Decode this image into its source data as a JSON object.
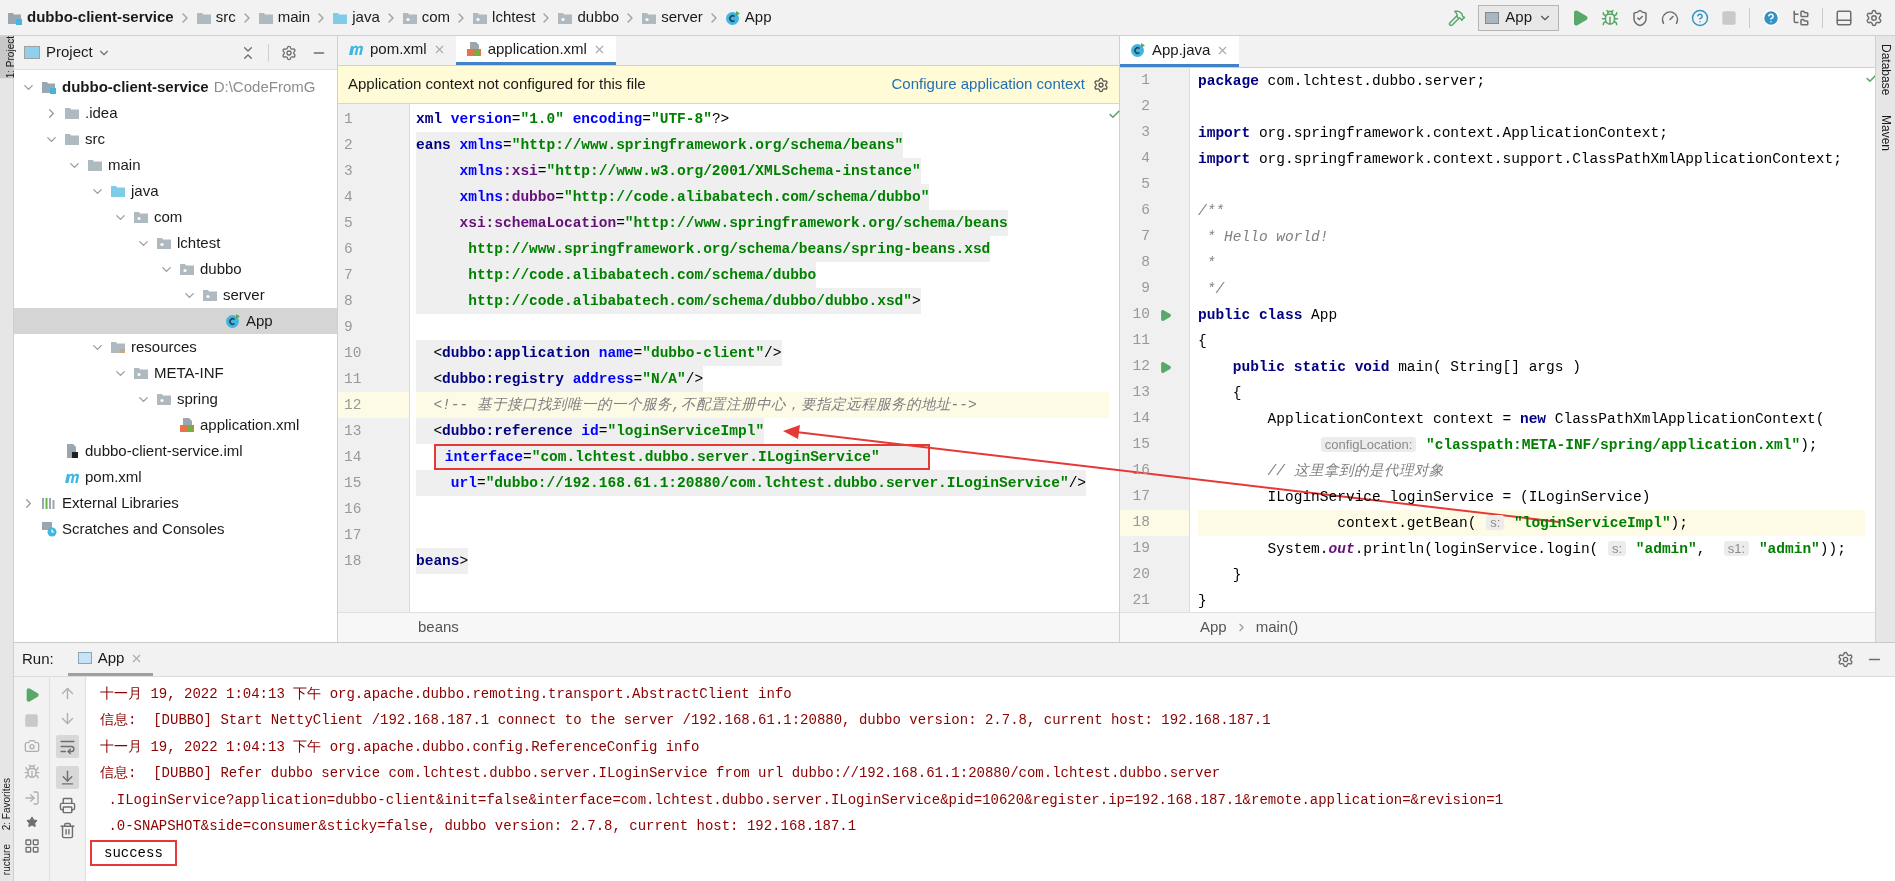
{
  "breadcrumb": [
    {
      "label": "dubbo-client-service",
      "kind": "module"
    },
    {
      "label": "src",
      "kind": "folder"
    },
    {
      "label": "main",
      "kind": "folder"
    },
    {
      "label": "java",
      "kind": "source"
    },
    {
      "label": "com",
      "kind": "package"
    },
    {
      "label": "lchtest",
      "kind": "package"
    },
    {
      "label": "dubbo",
      "kind": "package"
    },
    {
      "label": "server",
      "kind": "package"
    },
    {
      "label": "App",
      "kind": "class"
    }
  ],
  "run_config": {
    "label": "App"
  },
  "left_stripe": {
    "top": "1: Project",
    "bottom": [
      "2: Favorites",
      "ructure"
    ]
  },
  "right_stripe": [
    "Database",
    "Maven"
  ],
  "project": {
    "title": "Project",
    "tree": [
      {
        "label": "dubbo-client-service",
        "path": "D:\\CodeFromG",
        "kind": "module",
        "expanded": true,
        "selected": false,
        "children": [
          {
            "label": ".idea",
            "kind": "folder",
            "expanded": false,
            "selected": false
          },
          {
            "label": "src",
            "kind": "folder",
            "expanded": true,
            "selected": false,
            "children": [
              {
                "label": "main",
                "kind": "folder",
                "expanded": true,
                "selected": false,
                "children": [
                  {
                    "label": "java",
                    "kind": "source",
                    "expanded": true,
                    "selected": false,
                    "children": [
                      {
                        "label": "com",
                        "kind": "package",
                        "expanded": true,
                        "selected": false,
                        "children": [
                          {
                            "label": "lchtest",
                            "kind": "package",
                            "expanded": true,
                            "selected": false,
                            "children": [
                              {
                                "label": "dubbo",
                                "kind": "package",
                                "expanded": true,
                                "selected": false,
                                "children": [
                                  {
                                    "label": "server",
                                    "kind": "package",
                                    "expanded": true,
                                    "selected": false,
                                    "children": [
                                      {
                                        "label": "App",
                                        "kind": "class",
                                        "selected": true
                                      }
                                    ]
                                  }
                                ]
                              }
                            ]
                          }
                        ]
                      }
                    ]
                  },
                  {
                    "label": "resources",
                    "kind": "resources",
                    "expanded": true,
                    "selected": false,
                    "children": [
                      {
                        "label": "META-INF",
                        "kind": "package",
                        "expanded": true,
                        "selected": false,
                        "children": [
                          {
                            "label": "spring",
                            "kind": "package",
                            "expanded": true,
                            "selected": false,
                            "children": [
                              {
                                "label": "application.xml",
                                "kind": "xml",
                                "selected": false
                              }
                            ]
                          }
                        ]
                      }
                    ]
                  }
                ]
              }
            ]
          },
          {
            "label": "dubbo-client-service.iml",
            "kind": "iml",
            "selected": false
          },
          {
            "label": "pom.xml",
            "kind": "maven",
            "selected": false
          }
        ]
      },
      {
        "label": "External Libraries",
        "kind": "libraries",
        "expanded": false,
        "selected": false
      },
      {
        "label": "Scratches and Consoles",
        "kind": "scratches",
        "selected": false
      }
    ]
  },
  "xml_editor": {
    "tabs": [
      {
        "label": "pom.xml",
        "kind": "maven",
        "selected": false
      },
      {
        "label": "application.xml",
        "kind": "xml",
        "selected": true
      }
    ],
    "banner": {
      "text": "Application context not configured for this file",
      "link": "Configure application context"
    },
    "lines": [
      {
        "number": "1",
        "shaded": false,
        "current": false,
        "boxed": false,
        "tokens": [
          {
            "kind": "tag",
            "text": "xml"
          },
          {
            "kind": "attr",
            "text": " version"
          },
          {
            "kind": "plain",
            "text": "="
          },
          {
            "kind": "str",
            "text": "\"1.0\""
          },
          {
            "kind": "attr",
            "text": " encoding"
          },
          {
            "kind": "plain",
            "text": "="
          },
          {
            "kind": "str",
            "text": "\"UTF-8\""
          },
          {
            "kind": "plain",
            "text": "?>"
          }
        ]
      },
      {
        "number": "2",
        "shaded": true,
        "current": false,
        "boxed": false,
        "tokens": [
          {
            "kind": "tag",
            "text": "eans"
          },
          {
            "kind": "attr",
            "text": " xmlns"
          },
          {
            "kind": "plain",
            "text": "="
          },
          {
            "kind": "str",
            "text": "\"http://www.springframework.org/schema/beans\""
          }
        ]
      },
      {
        "number": "3",
        "shaded": true,
        "current": false,
        "boxed": false,
        "tokens": [
          {
            "kind": "attr",
            "text": "     xmlns"
          },
          {
            "kind": "ns",
            "text": ":xsi"
          },
          {
            "kind": "plain",
            "text": "="
          },
          {
            "kind": "str",
            "text": "\"http://www.w3.org/2001/XMLSchema-instance\""
          }
        ]
      },
      {
        "number": "4",
        "shaded": true,
        "current": false,
        "boxed": false,
        "tokens": [
          {
            "kind": "attr",
            "text": "     xmlns"
          },
          {
            "kind": "ns",
            "text": ":dubbo"
          },
          {
            "kind": "plain",
            "text": "="
          },
          {
            "kind": "str",
            "text": "\"http://code.alibabatech.com/schema/dubbo\""
          }
        ]
      },
      {
        "number": "5",
        "shaded": true,
        "current": false,
        "boxed": false,
        "tokens": [
          {
            "kind": "ns",
            "text": "     xsi:schemaLocation"
          },
          {
            "kind": "plain",
            "text": "="
          },
          {
            "kind": "str",
            "text": "\"http://www.springframework.org/schema/beans"
          }
        ]
      },
      {
        "number": "6",
        "shaded": true,
        "current": false,
        "boxed": false,
        "tokens": [
          {
            "kind": "str",
            "text": "      http://www.springframework.org/schema/beans/spring-beans.xsd"
          }
        ]
      },
      {
        "number": "7",
        "shaded": true,
        "current": false,
        "boxed": false,
        "tokens": [
          {
            "kind": "str",
            "text": "      http://code.alibabatech.com/schema/dubbo"
          }
        ]
      },
      {
        "number": "8",
        "shaded": true,
        "current": false,
        "boxed": false,
        "tokens": [
          {
            "kind": "str",
            "text": "      http://code.alibabatech.com/schema/dubbo/dubbo.xsd\""
          },
          {
            "kind": "plain",
            "text": ">"
          }
        ]
      },
      {
        "number": "9",
        "current": false
      },
      {
        "number": "10",
        "shaded": true,
        "current": false,
        "boxed": false,
        "tokens": [
          {
            "kind": "plain",
            "text": "  <"
          },
          {
            "kind": "tag",
            "text": "dubbo:application"
          },
          {
            "kind": "attr",
            "text": " name"
          },
          {
            "kind": "plain",
            "text": "="
          },
          {
            "kind": "str",
            "text": "\"dubbo-client\""
          },
          {
            "kind": "plain",
            "text": "/>"
          }
        ]
      },
      {
        "number": "11",
        "shaded": true,
        "current": false,
        "boxed": false,
        "tokens": [
          {
            "kind": "plain",
            "text": "  <"
          },
          {
            "kind": "tag",
            "text": "dubbo:registry"
          },
          {
            "kind": "attr",
            "text": " address"
          },
          {
            "kind": "plain",
            "text": "="
          },
          {
            "kind": "str",
            "text": "\"N/A\""
          },
          {
            "kind": "plain",
            "text": "/>"
          }
        ]
      },
      {
        "number": "12",
        "shaded": false,
        "current": true,
        "boxed": false,
        "tokens": [
          {
            "kind": "comment",
            "text": "  <!-- 基于接口找到唯一的一个服务,不配置注册中心，要指定远程服务的地址-->"
          }
        ]
      },
      {
        "number": "13",
        "shaded": true,
        "current": false,
        "boxed": false,
        "tokens": [
          {
            "kind": "plain",
            "text": "  <"
          },
          {
            "kind": "tag",
            "text": "dubbo:reference"
          },
          {
            "kind": "attr",
            "text": " id"
          },
          {
            "kind": "plain",
            "text": "="
          },
          {
            "kind": "str",
            "text": "\"loginServiceImpl\""
          }
        ]
      },
      {
        "number": "14",
        "shaded": true,
        "current": false,
        "boxed": true,
        "tokens": [
          {
            "kind": "attr",
            "text": " interface"
          },
          {
            "kind": "plain",
            "text": "="
          },
          {
            "kind": "str",
            "text": "\"com.lchtest.dubbo.server.ILoginService\""
          }
        ]
      },
      {
        "number": "15",
        "shaded": true,
        "current": false,
        "boxed": false,
        "tokens": [
          {
            "kind": "attr",
            "text": "    url"
          },
          {
            "kind": "plain",
            "text": "="
          },
          {
            "kind": "str",
            "text": "\"dubbo://192.168.61.1:20880/com.lchtest.dubbo.server.ILoginService\""
          },
          {
            "kind": "plain",
            "text": "/>"
          }
        ]
      },
      {
        "number": "16",
        "current": false
      },
      {
        "number": "17",
        "current": false
      },
      {
        "number": "18",
        "shaded": true,
        "current": false,
        "boxed": false,
        "tokens": [
          {
            "kind": "tag",
            "text": "beans"
          },
          {
            "kind": "plain",
            "text": ">"
          }
        ]
      }
    ],
    "crumbs": [
      "beans"
    ]
  },
  "java_editor": {
    "tabs": [
      {
        "label": "App.java",
        "kind": "class",
        "selected": true
      }
    ],
    "lines": [
      {
        "number": "1",
        "run": false,
        "current": false,
        "tokens": [
          {
            "kind": "kw",
            "text": "package"
          },
          {
            "kind": "plain",
            "text": " com.lchtest.dubbo.server;"
          }
        ]
      },
      {
        "number": "2",
        "run": false,
        "current": false
      },
      {
        "number": "3",
        "run": false,
        "current": false,
        "tokens": [
          {
            "kind": "kw",
            "text": "import"
          },
          {
            "kind": "plain",
            "text": " org.springframework.context.ApplicationContext;"
          }
        ]
      },
      {
        "number": "4",
        "run": false,
        "current": false,
        "tokens": [
          {
            "kind": "kw",
            "text": "import"
          },
          {
            "kind": "plain",
            "text": " org.springframework.context.support.ClassPathXmlApplicationContext;"
          }
        ]
      },
      {
        "number": "5",
        "run": false,
        "current": false
      },
      {
        "number": "6",
        "run": false,
        "current": false,
        "tokens": [
          {
            "kind": "comment",
            "text": "/**"
          }
        ]
      },
      {
        "number": "7",
        "run": false,
        "current": false,
        "tokens": [
          {
            "kind": "comment",
            "text": " * Hello world!"
          }
        ]
      },
      {
        "number": "8",
        "run": false,
        "current": false,
        "tokens": [
          {
            "kind": "comment",
            "text": " *"
          }
        ]
      },
      {
        "number": "9",
        "run": false,
        "current": false,
        "tokens": [
          {
            "kind": "comment",
            "text": " */"
          }
        ]
      },
      {
        "number": "10",
        "run": true,
        "current": false,
        "tokens": [
          {
            "kind": "kw",
            "text": "public class"
          },
          {
            "kind": "plain",
            "text": " App"
          }
        ]
      },
      {
        "number": "11",
        "run": false,
        "current": false,
        "tokens": [
          {
            "kind": "plain",
            "text": "{"
          }
        ]
      },
      {
        "number": "12",
        "run": true,
        "current": false,
        "tokens": [
          {
            "kind": "kw",
            "text": "    public static void"
          },
          {
            "kind": "plain",
            "text": " main( String[] args )"
          }
        ]
      },
      {
        "number": "13",
        "run": false,
        "current": false,
        "tokens": [
          {
            "kind": "plain",
            "text": "    {"
          }
        ]
      },
      {
        "number": "14",
        "run": false,
        "current": false,
        "tokens": [
          {
            "kind": "plain",
            "text": "        ApplicationContext context = "
          },
          {
            "kind": "kw",
            "text": "new"
          },
          {
            "kind": "plain",
            "text": " ClassPathXmlApplicationContext("
          }
        ]
      },
      {
        "number": "15",
        "run": false,
        "current": false,
        "tokens": [
          {
            "kind": "hint",
            "text": "              configLocation:"
          },
          {
            "kind": "str",
            "text": " \"classpath:META-INF/spring/application.xml\""
          },
          {
            "kind": "plain",
            "text": ");"
          }
        ]
      },
      {
        "number": "16",
        "run": false,
        "current": false,
        "tokens": [
          {
            "kind": "comment",
            "text": "        // 这里拿到的是代理对象"
          }
        ]
      },
      {
        "number": "17",
        "run": false,
        "current": false,
        "tokens": [
          {
            "kind": "plain",
            "text": "        ILoginService loginService = (ILoginService)"
          }
        ]
      },
      {
        "number": "18",
        "run": false,
        "current": true,
        "tokens": [
          {
            "kind": "plain",
            "text": "                context.getBean( "
          },
          {
            "kind": "hint",
            "text": "s:"
          },
          {
            "kind": "str",
            "text": " \"loginServiceImpl\""
          },
          {
            "kind": "plain",
            "text": ");"
          }
        ]
      },
      {
        "number": "19",
        "run": false,
        "current": false,
        "tokens": [
          {
            "kind": "plain",
            "text": "        System."
          },
          {
            "kind": "field",
            "text": "out"
          },
          {
            "kind": "plain",
            "text": ".println(loginService.login( "
          },
          {
            "kind": "hint",
            "text": "s:"
          },
          {
            "kind": "str",
            "text": " \"admin\""
          },
          {
            "kind": "plain",
            "text": ","
          },
          {
            "kind": "hint",
            "text": "  s1:"
          },
          {
            "kind": "str",
            "text": " \"admin\""
          },
          {
            "kind": "plain",
            "text": "));"
          }
        ]
      },
      {
        "number": "20",
        "run": false,
        "current": false,
        "tokens": [
          {
            "kind": "plain",
            "text": "    }"
          }
        ]
      },
      {
        "number": "21",
        "run": false,
        "current": false,
        "tokens": [
          {
            "kind": "plain",
            "text": "}"
          }
        ]
      }
    ],
    "crumbs": [
      "App",
      "main()"
    ]
  },
  "run_panel": {
    "label": "Run:",
    "tabs": [
      {
        "label": "App",
        "selected": true
      }
    ],
    "console": [
      {
        "kind": "log",
        "boxed": false,
        "text": "十一月 19, 2022 1:04:13 下午 org.apache.dubbo.remoting.transport.AbstractClient info"
      },
      {
        "kind": "log",
        "boxed": false,
        "text": "信息:  [DUBBO] Start NettyClient /192.168.187.1 connect to the server /192.168.61.1:20880, dubbo version: 2.7.8, current host: 192.168.187.1"
      },
      {
        "kind": "log",
        "boxed": false,
        "text": "十一月 19, 2022 1:04:13 下午 org.apache.dubbo.config.ReferenceConfig info"
      },
      {
        "kind": "log",
        "boxed": false,
        "text": "信息:  [DUBBO] Refer dubbo service com.lchtest.dubbo.server.ILoginService from url dubbo://192.168.61.1:20880/com.lchtest.dubbo.server"
      },
      {
        "kind": "log",
        "boxed": false,
        "text": " .ILoginService?application=dubbo-client&init=false&interface=com.lchtest.dubbo.server.ILoginService&pid=10620&register.ip=192.168.187.1&remote.application=&revision=1"
      },
      {
        "kind": "log",
        "boxed": false,
        "text": " .0-SNAPSHOT&side=consumer&sticky=false, dubbo version: 2.7.8, current host: 192.168.187.1"
      },
      {
        "kind": "output",
        "boxed": true,
        "text": "success"
      }
    ]
  }
}
